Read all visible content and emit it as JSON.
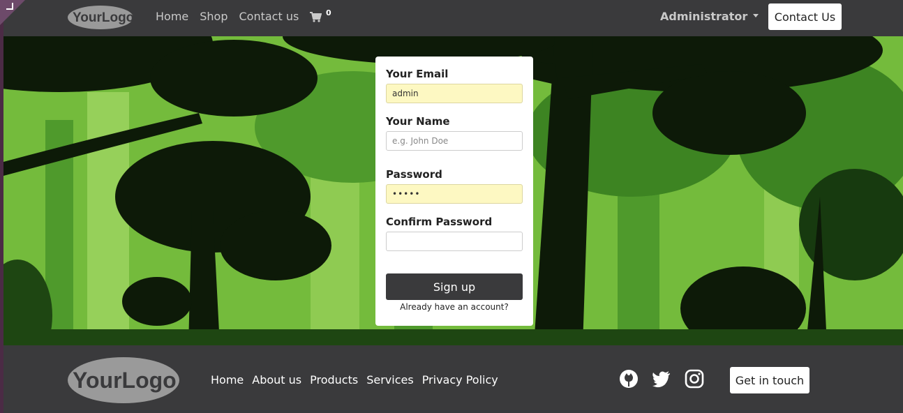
{
  "header": {
    "logo": "YourLogo",
    "nav": [
      "Home",
      "Shop",
      "Contact us"
    ],
    "cart_count": "0",
    "user": "Administrator",
    "contact_button": "Contact Us"
  },
  "signup_form": {
    "email_label": "Your Email",
    "email_value": "admin",
    "name_label": "Your Name",
    "name_placeholder": "e.g. John Doe",
    "password_label": "Password",
    "password_value": "•••••",
    "confirm_label": "Confirm Password",
    "confirm_value": "",
    "submit_label": "Sign up",
    "login_link": "Already have an account?"
  },
  "footer": {
    "logo": "YourLogo",
    "nav": [
      "Home",
      "About us",
      "Products",
      "Services",
      "Privacy Policy"
    ],
    "social_icons": [
      "github-icon",
      "twitter-icon",
      "instagram-icon"
    ],
    "cta": "Get in touch"
  },
  "colors": {
    "header_bg": "#3a3a3c",
    "input_filled_bg": "#fdf8c2",
    "button_dark": "#3a3a3c"
  }
}
